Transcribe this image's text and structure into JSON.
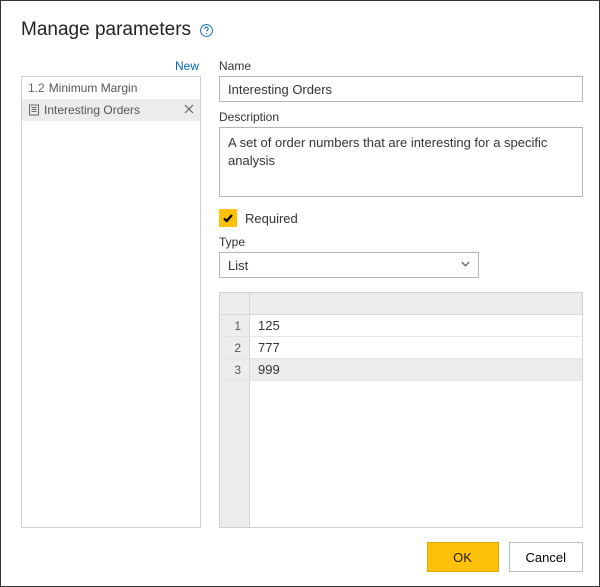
{
  "dialog": {
    "title": "Manage parameters",
    "new_label": "New"
  },
  "sidebar": {
    "items": [
      {
        "prefix": "1.2",
        "label": "Minimum Margin",
        "selected": false,
        "icon": null
      },
      {
        "prefix": "",
        "label": "Interesting Orders",
        "selected": true,
        "icon": "list-icon",
        "closable": true
      }
    ]
  },
  "form": {
    "name_label": "Name",
    "name_value": "Interesting Orders",
    "description_label": "Description",
    "description_value": "A set of order numbers that are interesting for a specific analysis",
    "required_label": "Required",
    "required_checked": true,
    "type_label": "Type",
    "type_value": "List"
  },
  "list_values": {
    "rows": [
      {
        "n": "1",
        "v": "125"
      },
      {
        "n": "2",
        "v": "777"
      },
      {
        "n": "3",
        "v": "999"
      }
    ]
  },
  "footer": {
    "ok": "OK",
    "cancel": "Cancel"
  }
}
